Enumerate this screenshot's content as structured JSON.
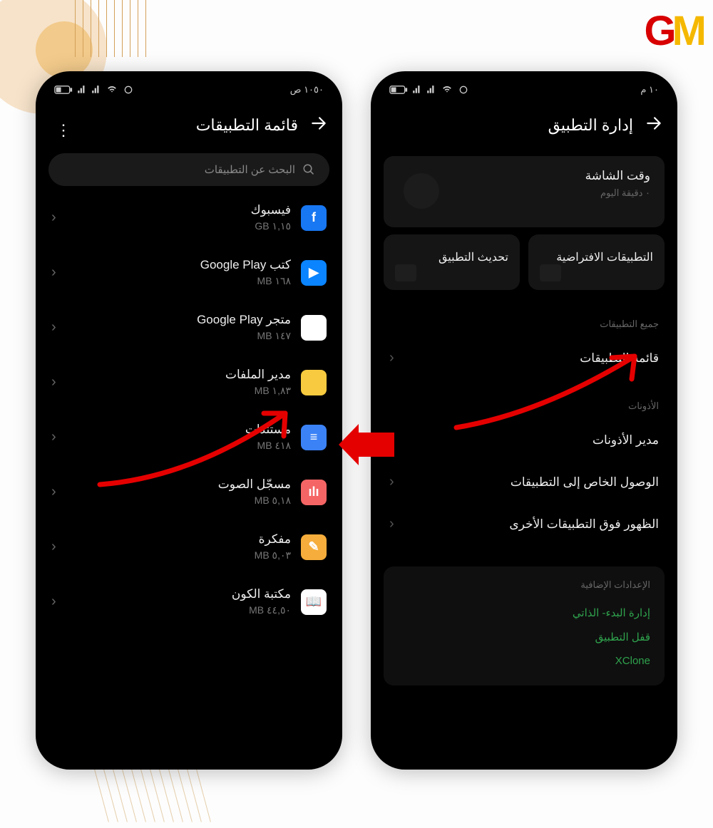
{
  "logo": {
    "g": "G",
    "m": "M"
  },
  "status_time_left": "١٠٥٠ ص",
  "status_time_right": "١٠ م",
  "left_phone": {
    "title": "قائمة التطبيقات",
    "search_placeholder": "البحث عن التطبيقات",
    "apps": [
      {
        "name": "فيسبوك",
        "size": "١,١٥ GB",
        "icon_class": "icon-fb",
        "glyph": "f"
      },
      {
        "name": "كتب Google Play",
        "size": "١٦٨ MB",
        "icon_class": "icon-books",
        "glyph": "▶"
      },
      {
        "name": "متجر Google Play",
        "size": "١٤٧ MB",
        "icon_class": "icon-play",
        "glyph": "▶"
      },
      {
        "name": "مدير الملفات",
        "size": "١,٨٣ MB",
        "icon_class": "icon-files",
        "glyph": ""
      },
      {
        "name": "مستندات",
        "size": "٤١٨ MB",
        "icon_class": "icon-docs",
        "glyph": "≡"
      },
      {
        "name": "مسجّل الصوت",
        "size": "٥,١٨ MB",
        "icon_class": "icon-rec",
        "glyph": "ılı"
      },
      {
        "name": "مفكرة",
        "size": "٥,٠٣ MB",
        "icon_class": "icon-notes",
        "glyph": "✎"
      },
      {
        "name": "مكتبة الكون",
        "size": "٤٤,٥٠ MB",
        "icon_class": "icon-lib",
        "glyph": "📖"
      }
    ]
  },
  "right_phone": {
    "title": "إدارة التطبيق",
    "screen_time": {
      "title": "وقت الشاشة",
      "sub": "٠ دقيقة اليوم"
    },
    "cards": {
      "default_apps": "التطبيقات الافتراضية",
      "update_app": "تحديث التطبيق"
    },
    "section_all_apps": "جميع التطبيقات",
    "row_app_list": "قائمة التطبيقات",
    "section_perms": "الأذونات",
    "row_perm_manager": "مدير الأذونات",
    "row_special_access": "الوصول الخاص إلى التطبيقات",
    "row_display_over": "الظهور فوق التطبيقات الأخرى",
    "extras_label": "الإعدادات الإضافية",
    "extras": {
      "autostart": "إدارة البدء- الذاتي",
      "applock": "قفل التطبيق",
      "xclone": "XClone"
    }
  }
}
